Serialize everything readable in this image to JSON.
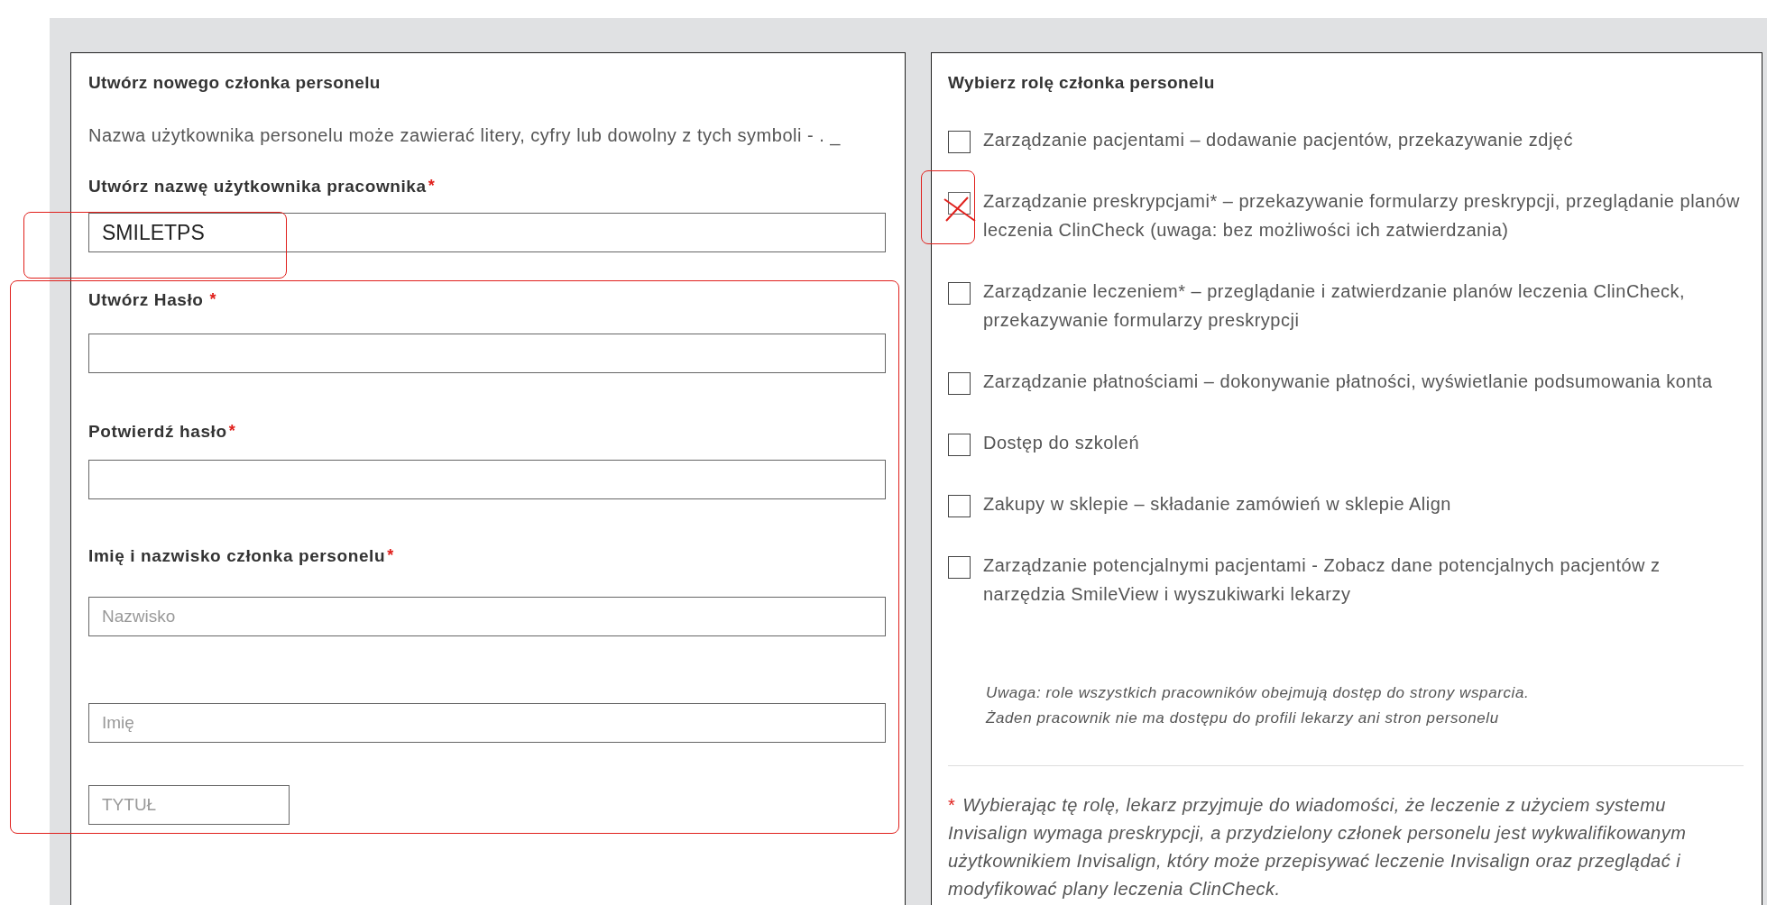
{
  "create_staff": {
    "title": "Utwórz nowego członka personelu",
    "hint": "Nazwa użytkownika personelu może zawierać litery, cyfry lub dowolny z tych symboli - . _",
    "fields": [
      {
        "label": "Utwórz nazwę użytkownika pracownika",
        "required_mark": "*",
        "kind": "text",
        "inputs": [
          {
            "value": "SMILETPS"
          }
        ]
      },
      {
        "label": "Utwórz Hasło",
        "required_mark": "*",
        "kind": "password"
      },
      {
        "label": "Potwierdź hasło",
        "required_mark": "*",
        "kind": "password"
      },
      {
        "label": "Imię i nazwisko członka personelu",
        "required_mark": "*",
        "kind": "text",
        "inputs": [
          {
            "placeholder": "Nazwisko"
          },
          {
            "placeholder": "Imię"
          },
          {
            "placeholder": "TYTUŁ"
          }
        ]
      }
    ]
  },
  "roles": {
    "title": "Wybierz rolę członka personelu",
    "options": [
      {
        "label": "Zarządzanie pacjentami – dodawanie pacjentów, przekazywanie zdjęć",
        "checked": false
      },
      {
        "label": "Zarządzanie preskrypcjami* – przekazywanie formularzy preskrypcji, przeglądanie planów leczenia ClinCheck (uwaga: bez możliwości ich zatwierdzania)",
        "checked": true
      },
      {
        "label": "Zarządzanie leczeniem* – przeglądanie i zatwierdzanie planów leczenia ClinCheck, przekazywanie formularzy preskrypcji",
        "checked": false
      },
      {
        "label": "Zarządzanie płatnościami – dokonywanie płatności, wyświetlanie podsumowania konta",
        "checked": false
      },
      {
        "label": "Dostęp do szkoleń",
        "checked": false
      },
      {
        "label": "Zakupy w sklepie – składanie zamówień w sklepie Align",
        "checked": false
      },
      {
        "label": "Zarządzanie potencjalnymi pacjentami - Zobacz dane potencjalnych pacjentów z narzędzia SmileView i wyszukiwarki lekarzy",
        "checked": false
      }
    ],
    "note_lines": [
      "Uwaga: role wszystkich pracowników obejmują dostęp do strony wsparcia.",
      "Żaden pracownik nie ma dostępu do profili lekarzy ani stron personelu"
    ],
    "footnote_mark": "*",
    "footnote": "Wybierając tę rolę, lekarz przyjmuje do wiadomości, że leczenie z użyciem systemu Invisalign wymaga preskrypcji, a przydzielony członek personelu jest wykwalifikowanym użytkownikiem Invisalign, który może przepisywać leczenie Invisalign oraz przeglądać i modyfikować plany leczenia ClinCheck."
  }
}
